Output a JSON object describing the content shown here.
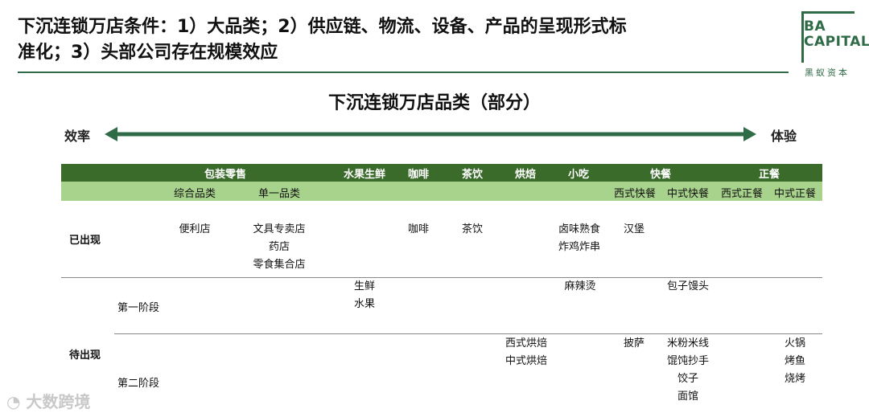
{
  "headline": {
    "line1": "下沉连锁万店条件：1）大品类；2）供应链、物流、设备、产品的呈现形式标",
    "line2": "准化；3）头部公司存在规模效应"
  },
  "logo": {
    "line1": "BA",
    "line2": "CAPITAL",
    "sub": "黑蚁资本"
  },
  "subtitle": "下沉连锁万店品类（部分）",
  "axis": {
    "left": "效率",
    "right": "体验",
    "color": "#2f6b47"
  },
  "categories": [
    "包装零售",
    "水果生鲜",
    "咖啡",
    "茶饮",
    "烘焙",
    "小吃",
    "快餐",
    "正餐"
  ],
  "subcategories": [
    "综合品类",
    "单一品类",
    "西式快餐",
    "中式快餐",
    "西式正餐",
    "中式正餐"
  ],
  "rows": {
    "existing": "已出现",
    "pending": "待出现",
    "stage1": "第一阶段",
    "stage2": "第二阶段"
  },
  "existing_cells": {
    "general": [
      "便利店"
    ],
    "single": [
      "文具专卖店",
      "药店",
      "零食集合店"
    ],
    "coffee": [
      "咖啡"
    ],
    "tea": [
      "茶饮"
    ],
    "snack": [
      "卤味熟食",
      "炸鸡炸串"
    ],
    "western_fast": [
      "汉堡"
    ]
  },
  "stage1_cells": {
    "fresh": [
      "生鲜",
      "水果"
    ],
    "snack": [
      "麻辣烫"
    ],
    "chinese_fast": [
      "包子馒头"
    ]
  },
  "stage2_cells": {
    "bakery": [
      "西式烘焙",
      "中式烘焙"
    ],
    "western_fast": [
      "披萨"
    ],
    "chinese_fast": [
      "米粉米线",
      "馄饨抄手",
      "饺子",
      "面馆"
    ],
    "chinese_meal": [
      "火锅",
      "烤鱼",
      "烧烤"
    ]
  },
  "colors": {
    "band_dark": "#3a6b2a",
    "band_light": "#a8d38c",
    "brand": "#2f6b47"
  },
  "watermark": "大数跨境"
}
